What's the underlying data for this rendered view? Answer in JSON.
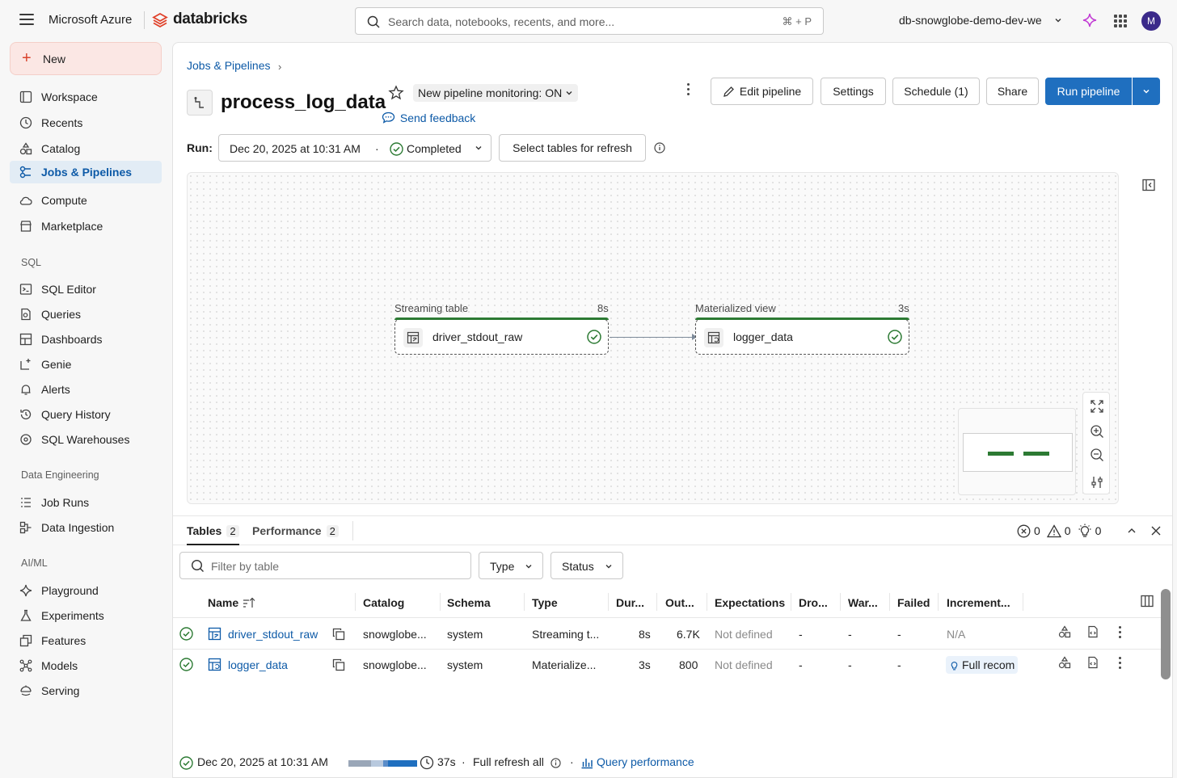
{
  "topbar": {
    "org": "Microsoft Azure",
    "brand": "databricks",
    "search_placeholder": "Search data, notebooks, recents, and more...",
    "search_shortcut": "⌘ + P",
    "workspace": "db-snowglobe-demo-dev-we",
    "avatar_initial": "M"
  },
  "sidebar": {
    "new_label": "New",
    "items": [
      {
        "label": "Workspace",
        "icon": "workspace-icon"
      },
      {
        "label": "Recents",
        "icon": "clock-icon"
      },
      {
        "label": "Catalog",
        "icon": "catalog-icon"
      },
      {
        "label": "Jobs & Pipelines",
        "icon": "jobs-icon",
        "active": true
      },
      {
        "label": "Compute",
        "icon": "cloud-icon"
      },
      {
        "label": "Marketplace",
        "icon": "store-icon"
      }
    ],
    "sql_section": "SQL",
    "sql_items": [
      {
        "label": "SQL Editor",
        "icon": "sql-editor-icon"
      },
      {
        "label": "Queries",
        "icon": "queries-icon"
      },
      {
        "label": "Dashboards",
        "icon": "dashboard-icon"
      },
      {
        "label": "Genie",
        "icon": "genie-icon"
      },
      {
        "label": "Alerts",
        "icon": "bell-icon"
      },
      {
        "label": "Query History",
        "icon": "history-icon"
      },
      {
        "label": "SQL Warehouses",
        "icon": "warehouse-icon"
      }
    ],
    "de_section": "Data Engineering",
    "de_items": [
      {
        "label": "Job Runs",
        "icon": "job-runs-icon"
      },
      {
        "label": "Data Ingestion",
        "icon": "ingestion-icon"
      }
    ],
    "ml_section": "AI/ML",
    "ml_items": [
      {
        "label": "Playground",
        "icon": "sparkle-icon"
      },
      {
        "label": "Experiments",
        "icon": "flask-icon"
      },
      {
        "label": "Features",
        "icon": "features-icon"
      },
      {
        "label": "Models",
        "icon": "models-icon"
      },
      {
        "label": "Serving",
        "icon": "serving-icon"
      }
    ]
  },
  "page": {
    "breadcrumb": "Jobs & Pipelines",
    "title": "process_log_data",
    "monitoring": "New pipeline monitoring: ON",
    "feedback": "Send feedback",
    "buttons": {
      "edit": "Edit pipeline",
      "settings": "Settings",
      "schedule": "Schedule (1)",
      "share": "Share",
      "run": "Run pipeline"
    },
    "run_label": "Run:",
    "run_date": "Dec 20, 2025 at 10:31 AM",
    "run_sep": "·",
    "run_status": "Completed",
    "select_tables": "Select tables for refresh"
  },
  "graph": {
    "nodes": [
      {
        "type": "Streaming table",
        "duration": "8s",
        "name": "driver_stdout_raw",
        "status": "success"
      },
      {
        "type": "Materialized view",
        "duration": "3s",
        "name": "logger_data",
        "status": "success"
      }
    ]
  },
  "bottom": {
    "tabs": [
      {
        "label": "Tables",
        "count": "2"
      },
      {
        "label": "Performance",
        "count": "2"
      }
    ],
    "errors": "0",
    "warnings": "0",
    "info": "0",
    "filter_placeholder": "Filter by table",
    "type_filter": "Type",
    "status_filter": "Status",
    "columns": [
      "Name",
      "Catalog",
      "Schema",
      "Type",
      "Dur...",
      "Out...",
      "Expectations",
      "Dro...",
      "War...",
      "Failed",
      "Increment..."
    ],
    "rows": [
      {
        "name": "driver_stdout_raw",
        "catalog": "snowglobe...",
        "schema": "system",
        "type": "Streaming t...",
        "duration": "8s",
        "output": "6.7K",
        "expectations": "Not defined",
        "dropped": "-",
        "warned": "-",
        "failed": "-",
        "incremental": "N/A"
      },
      {
        "name": "logger_data",
        "catalog": "snowglobe...",
        "schema": "system",
        "type": "Materialize...",
        "duration": "3s",
        "output": "800",
        "expectations": "Not defined",
        "dropped": "-",
        "warned": "-",
        "failed": "-",
        "incremental": "Full recom"
      }
    ],
    "footer": {
      "date": "Dec 20, 2025 at 10:31 AM",
      "duration": "37s",
      "sep": "·",
      "refresh": "Full refresh all",
      "sep2": "·",
      "query_perf": "Query performance"
    }
  },
  "colors": {
    "accent": "#1f6fbf",
    "link": "#0d5aa7",
    "success": "#2c7a33",
    "brand": "#e0412a"
  }
}
